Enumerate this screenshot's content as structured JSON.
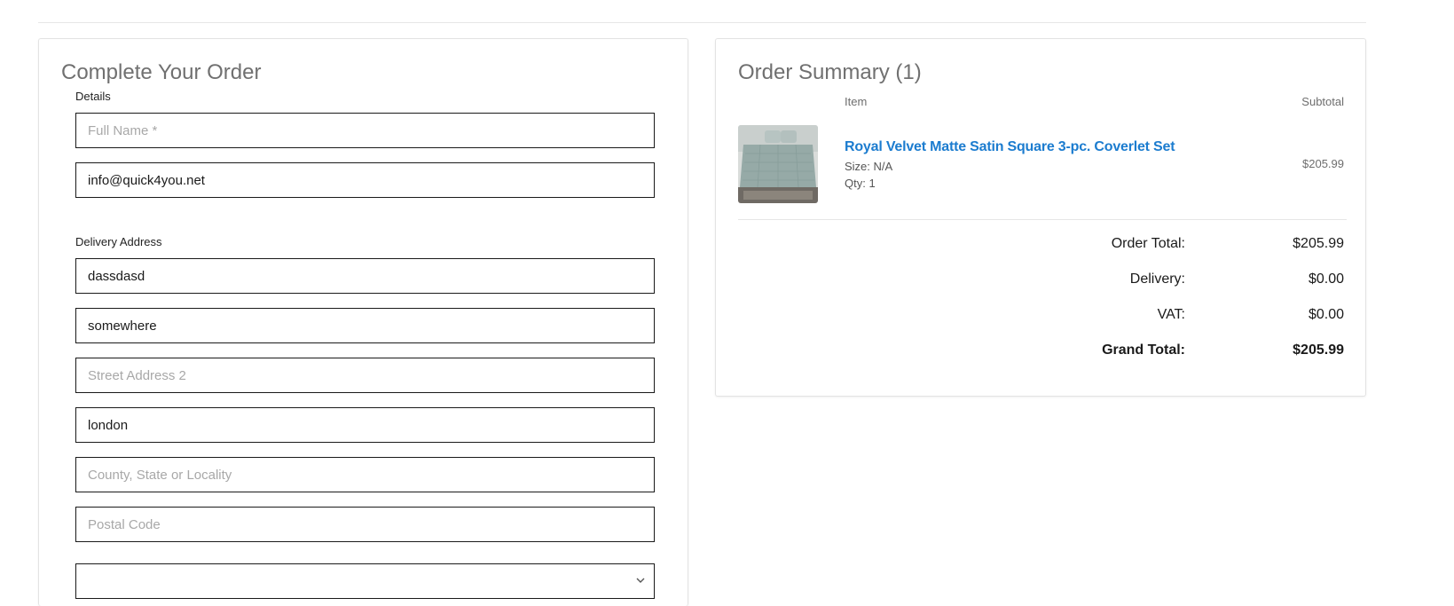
{
  "order_form": {
    "title": "Complete Your Order",
    "details_label": "Details",
    "full_name": {
      "value": "",
      "placeholder": "Full Name *"
    },
    "email": {
      "value": "info@quick4you.net",
      "placeholder": ""
    },
    "delivery_label": "Delivery Address",
    "street_address_1": {
      "value": "dassdasd",
      "placeholder": ""
    },
    "street_address_2_value": {
      "value": "somewhere",
      "placeholder": ""
    },
    "street_address_2": {
      "value": "",
      "placeholder": "Street Address 2"
    },
    "city": {
      "value": "london",
      "placeholder": ""
    },
    "county": {
      "value": "",
      "placeholder": "County, State or Locality"
    },
    "postal_code": {
      "value": "",
      "placeholder": "Postal Code"
    },
    "country_select": {
      "value": ""
    }
  },
  "order_summary": {
    "title": "Order Summary (1)",
    "col_item": "Item",
    "col_subtotal": "Subtotal",
    "items": [
      {
        "name": "Royal Velvet Matte Satin Square 3-pc. Coverlet Set",
        "size": "Size: N/A",
        "qty": "Qty: 1",
        "subtotal": "$205.99"
      }
    ],
    "totals": {
      "order_total_label": "Order Total:",
      "order_total_value": "$205.99",
      "delivery_label": "Delivery:",
      "delivery_value": "$0.00",
      "vat_label": "VAT:",
      "vat_value": "$0.00",
      "grand_total_label": "Grand Total:",
      "grand_total_value": "$205.99"
    }
  },
  "colors": {
    "link": "#1c7ccf",
    "title": "#707070",
    "field_border": "#1a1a1a"
  }
}
